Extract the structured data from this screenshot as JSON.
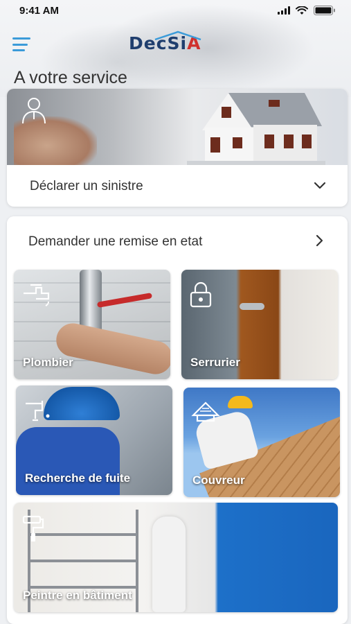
{
  "status_bar": {
    "time": "9:41 AM"
  },
  "header": {
    "logo_main": "DecSi",
    "logo_accent": "A"
  },
  "page_title": "A votre service",
  "sinistre": {
    "label": "Déclarer un sinistre",
    "icon": "chevron-down-icon"
  },
  "remise": {
    "label": "Demander une remise en etat",
    "icon": "chevron-right-icon",
    "services": [
      {
        "label": "Plombier",
        "icon": "faucet-icon"
      },
      {
        "label": "Serrurier",
        "icon": "lock-icon"
      },
      {
        "label": "Recherche de fuite",
        "icon": "pipe-leak-icon"
      },
      {
        "label": "Couvreur",
        "icon": "roof-icon"
      },
      {
        "label": "Peintre en bâtiment",
        "icon": "paint-roller-icon"
      }
    ]
  },
  "colors": {
    "accent": "#3b9bd9",
    "logo": "#1f3e6e",
    "logo_accent": "#d0312d"
  }
}
